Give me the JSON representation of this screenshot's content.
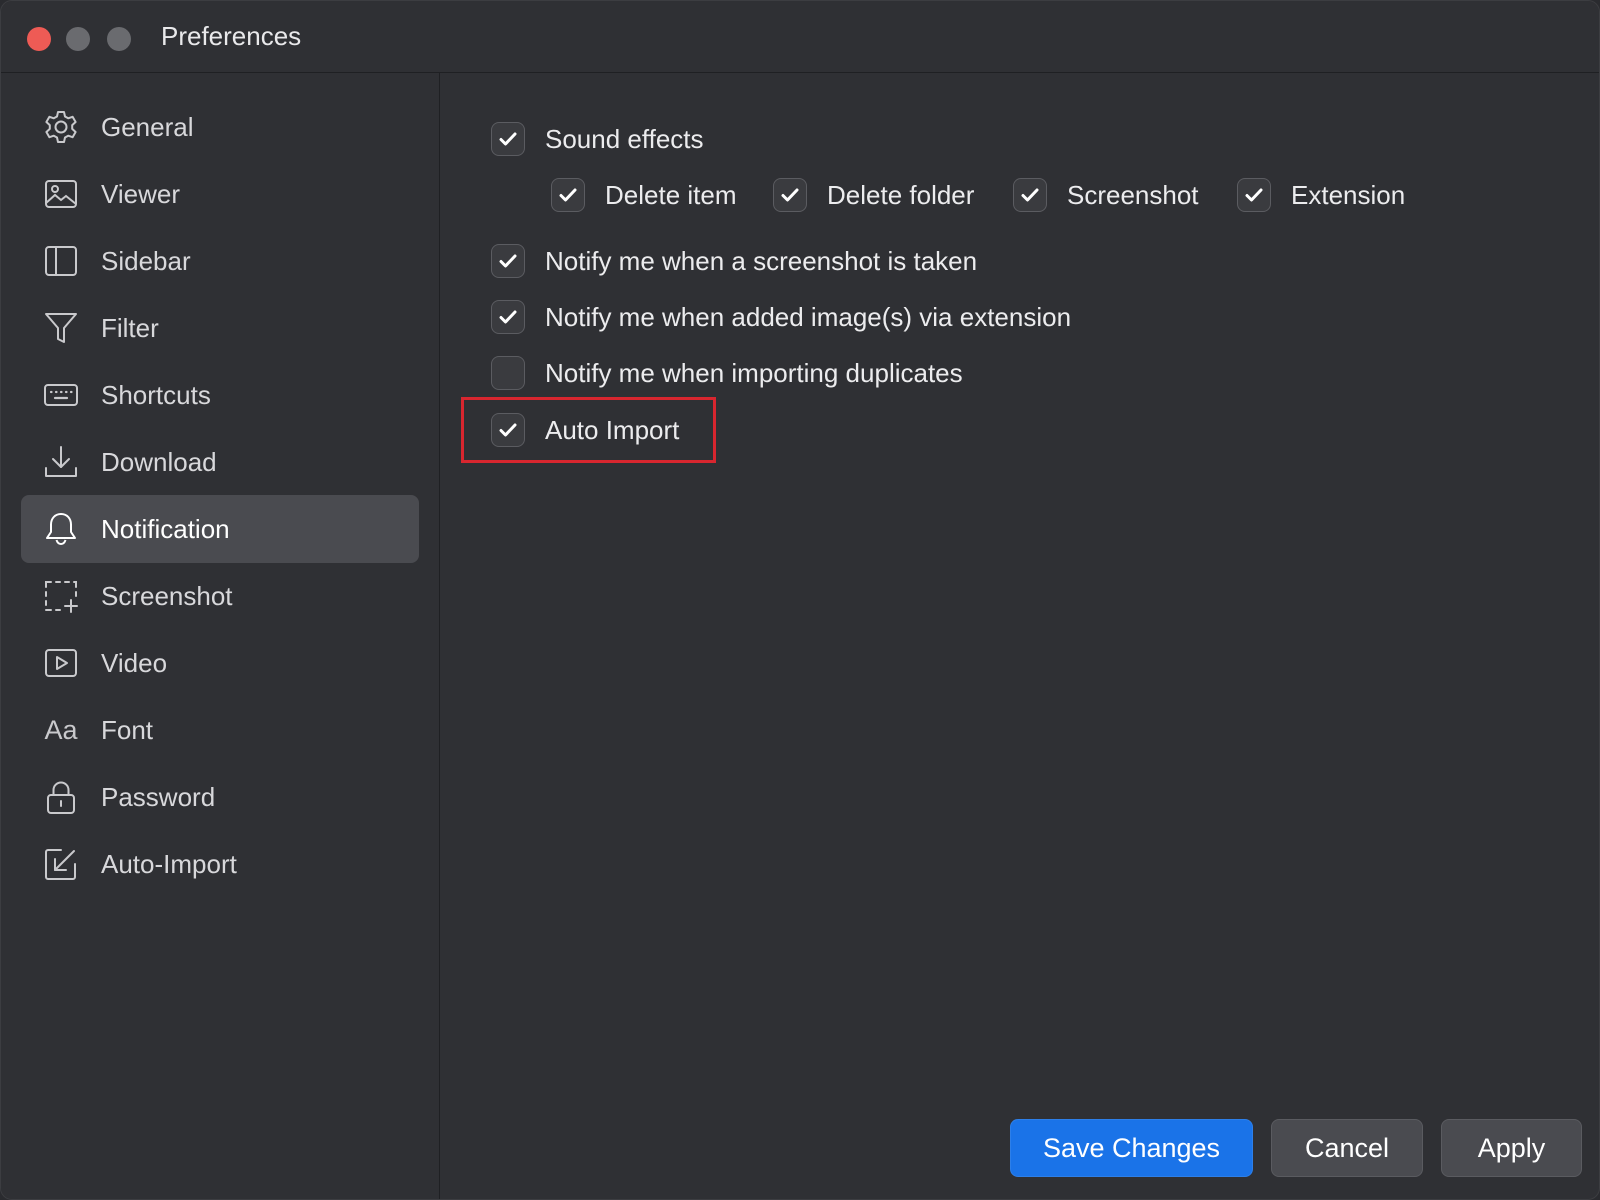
{
  "window": {
    "title": "Preferences",
    "traffic_lights": {
      "close_color": "#ee5b55",
      "inactive_color": "#6a6b6f"
    }
  },
  "sidebar": {
    "items": [
      {
        "label": "General",
        "icon": "gear-icon"
      },
      {
        "label": "Viewer",
        "icon": "image-icon"
      },
      {
        "label": "Sidebar",
        "icon": "sidebar-icon"
      },
      {
        "label": "Filter",
        "icon": "filter-icon"
      },
      {
        "label": "Shortcuts",
        "icon": "keyboard-icon"
      },
      {
        "label": "Download",
        "icon": "download-icon"
      },
      {
        "label": "Notification",
        "icon": "bell-icon",
        "active": true
      },
      {
        "label": "Screenshot",
        "icon": "screenshot-icon"
      },
      {
        "label": "Video",
        "icon": "video-icon"
      },
      {
        "label": "Font",
        "icon": "font-icon"
      },
      {
        "label": "Password",
        "icon": "lock-icon"
      },
      {
        "label": "Auto-Import",
        "icon": "auto-import-icon"
      }
    ],
    "font_icon_glyph": "Aa"
  },
  "notification": {
    "sound_effects": {
      "label": "Sound effects",
      "checked": true
    },
    "sound_sub": [
      {
        "label": "Delete item",
        "checked": true
      },
      {
        "label": "Delete folder",
        "checked": true
      },
      {
        "label": "Screenshot",
        "checked": true
      },
      {
        "label": "Extension",
        "checked": true
      }
    ],
    "options": [
      {
        "label": "Notify me when a screenshot is taken",
        "checked": true
      },
      {
        "label": "Notify me when added image(s) via extension",
        "checked": true
      },
      {
        "label": "Notify me when importing duplicates",
        "checked": false
      },
      {
        "label": "Auto Import",
        "checked": true,
        "highlighted": true
      }
    ]
  },
  "footer": {
    "save_label": "Save Changes",
    "cancel_label": "Cancel",
    "apply_label": "Apply"
  },
  "colors": {
    "accent": "#1a73e8",
    "highlight_border": "#d8262f",
    "active_nav_bg": "#4a4b50"
  }
}
